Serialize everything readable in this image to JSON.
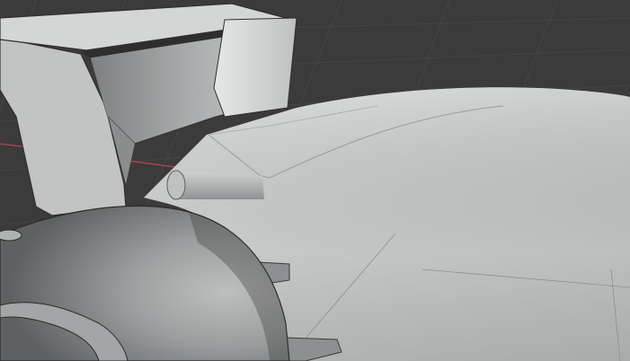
{
  "viewport": {
    "background_color": "#3b3b3b",
    "grid_color": "#454545",
    "x_axis_color": "#b8454f",
    "model_base_color": "#c4c6c6",
    "model_shadow_color": "#6d6f70",
    "model_highlight_color": "#dcdede",
    "edge_color": "#2f2f2f"
  }
}
